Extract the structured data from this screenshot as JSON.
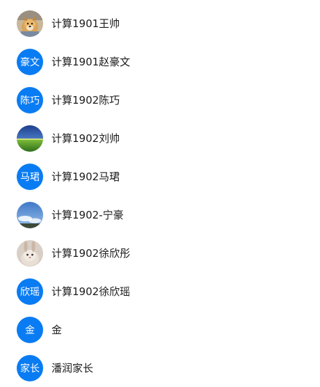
{
  "contacts": [
    {
      "name": "计算1901王帅",
      "avatar_type": "photo",
      "avatar_subject": "dog-photo"
    },
    {
      "name": "计算1901赵豪文",
      "avatar_type": "text",
      "avatar_text": "豪文",
      "avatar_color": "#0a7cf3"
    },
    {
      "name": "计算1902陈巧",
      "avatar_type": "text",
      "avatar_text": "陈巧",
      "avatar_color": "#0a7cf3"
    },
    {
      "name": "计算1902刘帅",
      "avatar_type": "photo",
      "avatar_subject": "grassland-photo"
    },
    {
      "name": "计算1902马珺",
      "avatar_type": "text",
      "avatar_text": "马珺",
      "avatar_color": "#0a7cf3"
    },
    {
      "name": "计算1902-宁豪",
      "avatar_type": "photo",
      "avatar_subject": "sky-photo"
    },
    {
      "name": "计算1902徐欣彤",
      "avatar_type": "photo",
      "avatar_subject": "rabbit-photo"
    },
    {
      "name": "计算1902徐欣瑶",
      "avatar_type": "text",
      "avatar_text": "欣瑶",
      "avatar_color": "#0a7cf3"
    },
    {
      "name": "金",
      "avatar_type": "text",
      "avatar_text": "金",
      "avatar_color": "#0a7cf3"
    },
    {
      "name": "潘润家长",
      "avatar_type": "text",
      "avatar_text": "家长",
      "avatar_color": "#0a7cf3"
    }
  ]
}
